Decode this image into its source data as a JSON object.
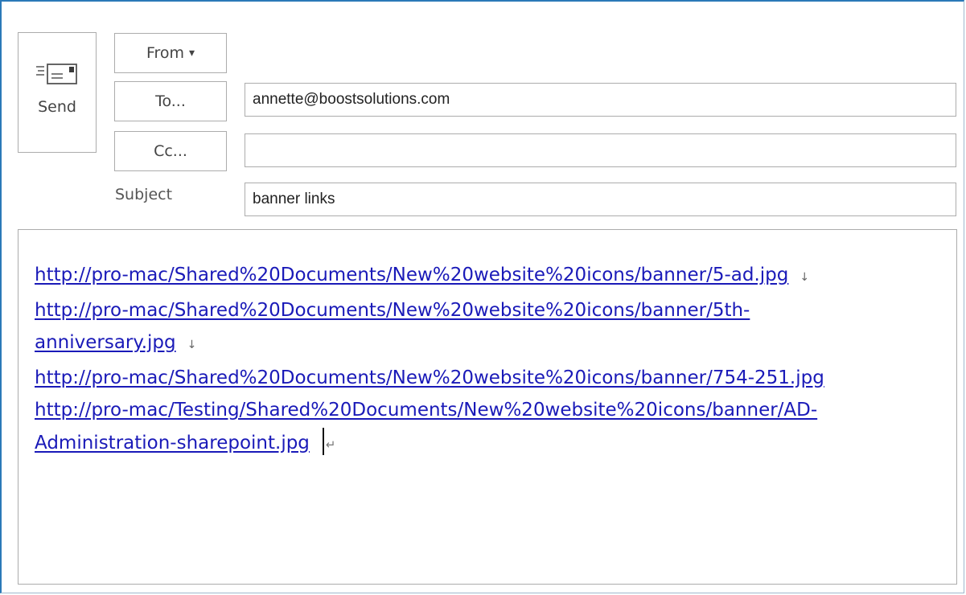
{
  "toolbar": {
    "send_label": "Send",
    "send_icon": "envelope-send-icon",
    "from_label": "From",
    "from_caret": "▾",
    "to_label": "To...",
    "cc_label": "Cc...",
    "subject_label": "Subject"
  },
  "fields": {
    "to_value": "annette@boostsolutions.com",
    "cc_value": "",
    "subject_value": "banner links"
  },
  "body": {
    "line1": "http://pro-mac/Shared%20Documents/New%20website%20icons/banner/5-ad.jpg",
    "line2a": "http://pro-mac/Shared%20Documents/New%20website%20icons/banner/5th-",
    "line2b": "anniversary.jpg",
    "line3": "http://pro-mac/Shared%20Documents/New%20website%20icons/banner/754-251.jpg",
    "line4a": "http://pro-mac/Testing/Shared%20Documents/New%20website%20icons/banner/AD-",
    "line4b": "Administration-sharepoint.jpg",
    "line_break_mark": "↓",
    "paragraph_mark": "↵"
  },
  "colors": {
    "link": "#1a1ab8",
    "frame_accent": "#2b79b8",
    "border": "#acacac"
  }
}
